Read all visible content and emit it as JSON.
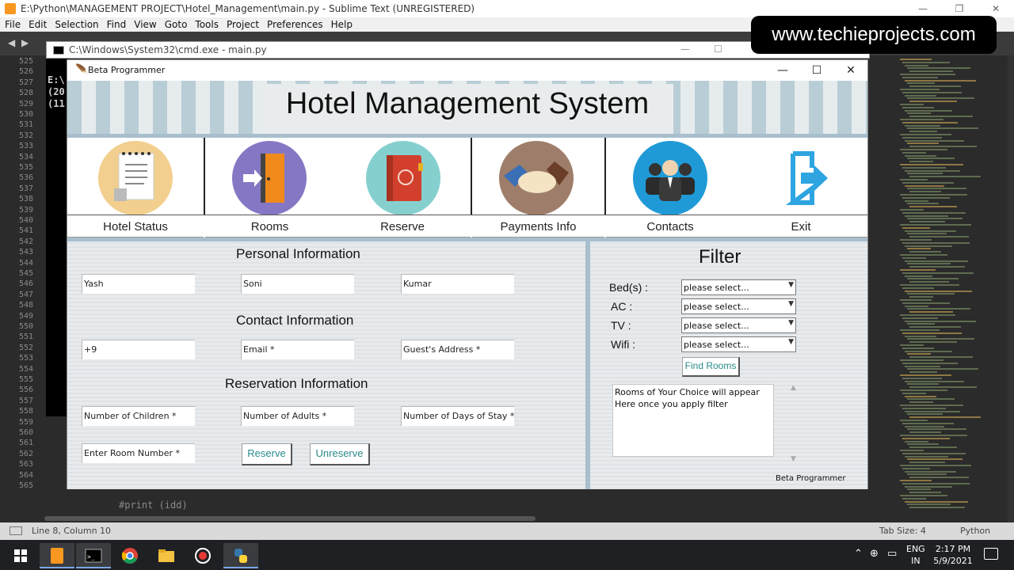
{
  "sublime": {
    "title": "E:\\Python\\MANAGEMENT PROJECT\\Hotel_Management\\main.py - Sublime Text (UNREGISTERED)",
    "menu": [
      "File",
      "Edit",
      "Selection",
      "Find",
      "View",
      "Goto",
      "Tools",
      "Project",
      "Preferences",
      "Help"
    ],
    "line_numbers": [
      "525",
      "526",
      "527",
      "528",
      "529",
      "530",
      "531",
      "532",
      "533",
      "534",
      "535",
      "536",
      "537",
      "538",
      "539",
      "540",
      "541",
      "542",
      "543",
      "544",
      "545",
      "546",
      "547",
      "548",
      "549",
      "550",
      "551",
      "552",
      "553",
      "554",
      "555",
      "556",
      "557",
      "558",
      "559",
      "560",
      "561",
      "562",
      "563",
      "564",
      "565"
    ],
    "code_line": "#print (idd)",
    "status_left": "Line 8, Column 10",
    "tab_size": "Tab Size: 4",
    "syntax": "Python"
  },
  "cmd": {
    "title": "C:\\Windows\\System32\\cmd.exe - main.py",
    "lines": [
      "E:\\",
      "(20",
      "(11"
    ]
  },
  "watermark": "www.techieprojects.com",
  "app": {
    "window_title": "Beta Programmer",
    "banner_title": "Hotel Management System",
    "nav": [
      {
        "label": "Hotel Status",
        "icon": "notepad-icon"
      },
      {
        "label": "Rooms",
        "icon": "door-icon"
      },
      {
        "label": "Reserve",
        "icon": "book-icon"
      },
      {
        "label": "Payments Info",
        "icon": "handshake-icon"
      },
      {
        "label": "Contacts",
        "icon": "people-icon"
      },
      {
        "label": "Exit",
        "icon": "exit-icon"
      }
    ],
    "sections": {
      "personal": "Personal Information",
      "contact": "Contact Information",
      "reservation": "Reservation Information"
    },
    "fields": {
      "first_name": "Yash",
      "middle_name": "Soni",
      "last_name": "Kumar",
      "phone": "+9",
      "email": "Email *",
      "address": "Guest's Address *",
      "children": "Number of Children *",
      "adults": "Number of Adults *",
      "days": "Number of Days of Stay *",
      "room": "Enter Room Number *"
    },
    "buttons": {
      "reserve": "Reserve",
      "unreserve": "Unreserve",
      "find_rooms": "Find Rooms"
    },
    "filter": {
      "title": "Filter",
      "labels": {
        "beds": "Bed(s) :",
        "ac": "AC :",
        "tv": "TV :",
        "wifi": "Wifi :"
      },
      "select_placeholder": "please select...",
      "results_text": "Rooms of Your Choice will appear Here once you apply filter",
      "credit": "Beta Programmer"
    }
  },
  "taskbar": {
    "lang_line1": "ENG",
    "lang_line2": "IN",
    "time": "2:17 PM",
    "date": "5/9/2021"
  }
}
